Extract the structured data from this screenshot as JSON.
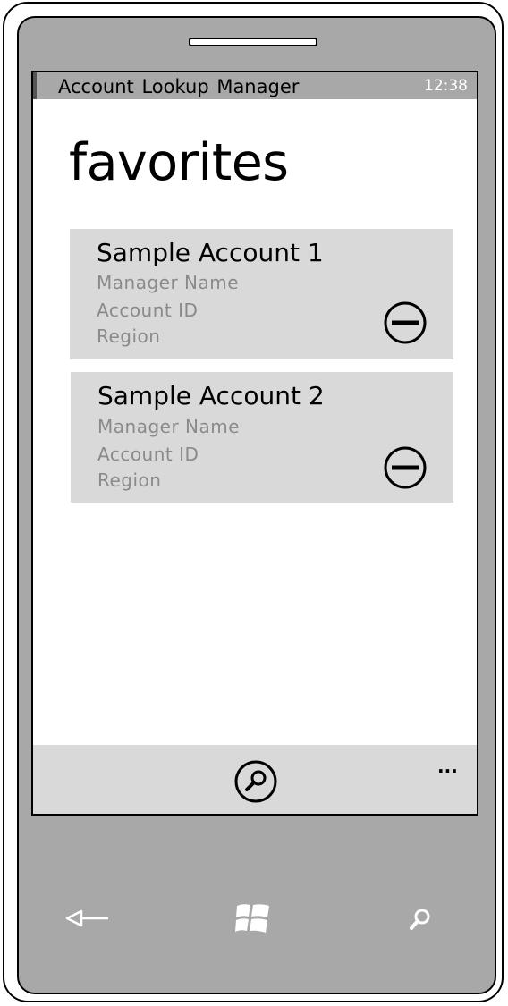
{
  "status_bar": {
    "app_title": "Account Lookup Manager",
    "time": "12:38"
  },
  "page": {
    "title": "favorites"
  },
  "accounts": [
    {
      "name": "Sample Account 1",
      "manager": "Manager Name",
      "account_id": "Account ID",
      "region": "Region"
    },
    {
      "name": "Sample Account 2",
      "manager": "Manager Name",
      "account_id": "Account ID",
      "region": "Region"
    }
  ],
  "app_bar": {
    "more": "..."
  },
  "icons": {
    "remove": "minus-circle-icon",
    "search": "search-icon",
    "back": "back-arrow-icon",
    "start": "windows-logo-icon",
    "hardware_search": "search-icon"
  },
  "colors": {
    "phone_body": "#a8a8a8",
    "card_bg": "#d9d9d9",
    "secondary_text": "#8a8a8a"
  }
}
